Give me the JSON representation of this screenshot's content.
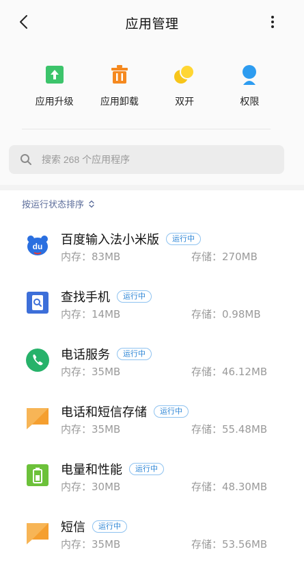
{
  "header": {
    "title": "应用管理"
  },
  "quick_actions": [
    {
      "label": "应用升级",
      "icon": "upgrade-icon"
    },
    {
      "label": "应用卸载",
      "icon": "trash-icon"
    },
    {
      "label": "双开",
      "icon": "dual-app-icon"
    },
    {
      "label": "权限",
      "icon": "permission-icon"
    }
  ],
  "search": {
    "placeholder": "搜索 268 个应用程序"
  },
  "sort": {
    "label": "按运行状态排序"
  },
  "apps": [
    {
      "name": "百度输入法小米版",
      "status": "运行中",
      "memory": "内存：83MB",
      "storage": "存储：270MB",
      "icon": "baidu-input-icon"
    },
    {
      "name": "查找手机",
      "status": "运行中",
      "memory": "内存：14MB",
      "storage": "存储：0.98MB",
      "icon": "find-phone-icon"
    },
    {
      "name": "电话服务",
      "status": "运行中",
      "memory": "内存：35MB",
      "storage": "存储：46.12MB",
      "icon": "phone-service-icon"
    },
    {
      "name": "电话和短信存储",
      "status": "运行中",
      "memory": "内存：35MB",
      "storage": "存储：55.48MB",
      "icon": "message-storage-icon"
    },
    {
      "name": "电量和性能",
      "status": "运行中",
      "memory": "内存：30MB",
      "storage": "存储：48.30MB",
      "icon": "battery-icon"
    },
    {
      "name": "短信",
      "status": "运行中",
      "memory": "内存：35MB",
      "storage": "存储：53.56MB",
      "icon": "sms-icon"
    }
  ],
  "colors": {
    "accent_blue": "#2d86d6",
    "badge_border": "#8ec2f0",
    "sort_text": "#5b6c9a",
    "upgrade_green": "#3cc46b",
    "trash_orange": "#f5891f",
    "dual_yellow": "#f7c51a",
    "permission_blue": "#2d9cf0",
    "find_phone_blue": "#3d6fd9",
    "phone_green": "#27b26a",
    "battery_green": "#6cc13a",
    "message_orange": "#f7b556"
  }
}
